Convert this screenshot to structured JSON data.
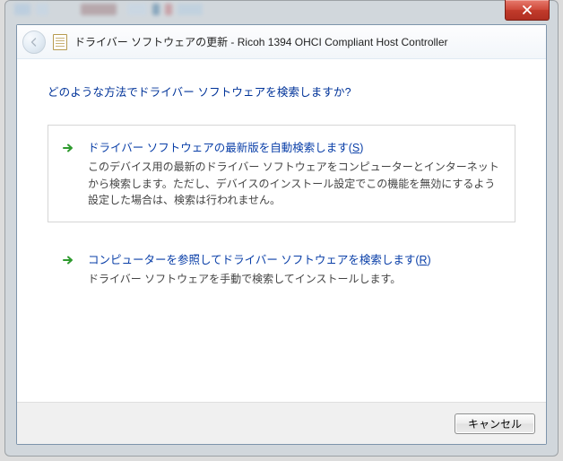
{
  "window": {
    "title": "ドライバー ソフトウェアの更新 - Ricoh 1394 OHCI Compliant Host Controller"
  },
  "instruction": "どのような方法でドライバー ソフトウェアを検索しますか?",
  "options": [
    {
      "title_pre": "ドライバー ソフトウェアの最新版を自動検索します(",
      "title_accel": "S",
      "title_post": ")",
      "desc": "このデバイス用の最新のドライバー ソフトウェアをコンピューターとインターネットから検索します。ただし、デバイスのインストール設定でこの機能を無効にするよう設定した場合は、検索は行われません。"
    },
    {
      "title_pre": "コンピューターを参照してドライバー ソフトウェアを検索します(",
      "title_accel": "R",
      "title_post": ")",
      "desc": "ドライバー ソフトウェアを手動で検索してインストールします。"
    }
  ],
  "footer": {
    "cancel": "キャンセル"
  }
}
